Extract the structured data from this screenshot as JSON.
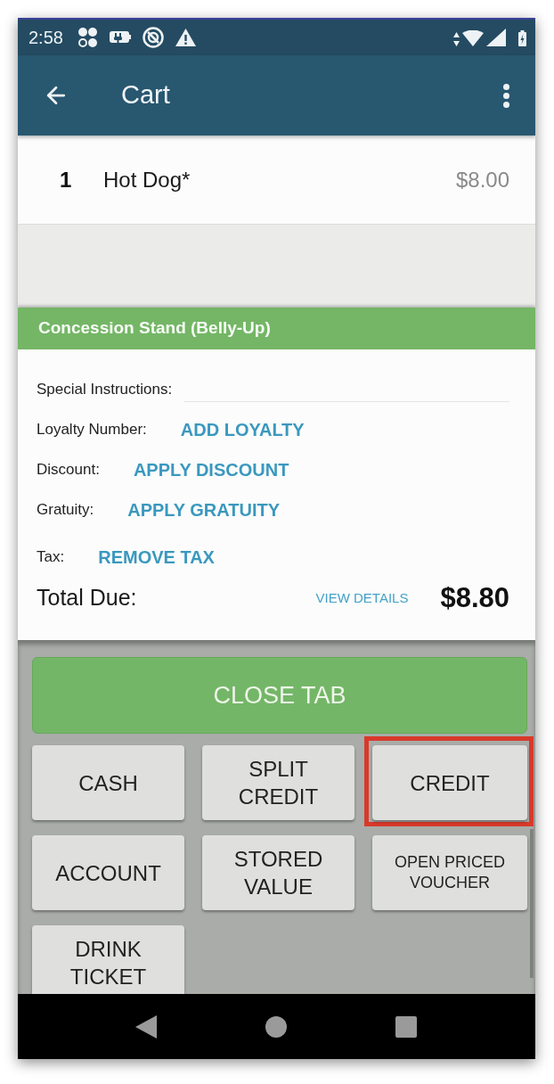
{
  "status_bar": {
    "time": "2:58"
  },
  "app_bar": {
    "title": "Cart"
  },
  "cart_items": [
    {
      "quantity": "1",
      "name": "Hot Dog*",
      "price": "$8.00"
    }
  ],
  "order": {
    "header": "Concession Stand (Belly-Up)",
    "fields": [
      {
        "kind": "input",
        "label": "Special Instructions:"
      },
      {
        "kind": "link",
        "label": "Loyalty Number:",
        "action": "ADD LOYALTY"
      },
      {
        "kind": "link",
        "label": "Discount:",
        "action": "APPLY DISCOUNT"
      },
      {
        "kind": "link",
        "label": "Gratuity:",
        "action": "APPLY GRATUITY"
      },
      {
        "kind": "link",
        "label": "Tax:",
        "action": "REMOVE TAX"
      }
    ],
    "total": {
      "label": "Total Due:",
      "link": "VIEW DETAILS",
      "amount": "$8.80"
    }
  },
  "close_tab_button": "CLOSE TAB",
  "payment_buttons": [
    {
      "label": "CASH",
      "highlighted": false
    },
    {
      "label": "SPLIT CREDIT",
      "highlighted": false
    },
    {
      "label": "CREDIT",
      "highlighted": true
    },
    {
      "label": "ACCOUNT",
      "highlighted": false
    },
    {
      "label": "STORED VALUE",
      "highlighted": false
    },
    {
      "label": "OPEN PRICED VOUCHER",
      "highlighted": false
    },
    {
      "label": "DRINK TICKET",
      "highlighted": false
    }
  ]
}
